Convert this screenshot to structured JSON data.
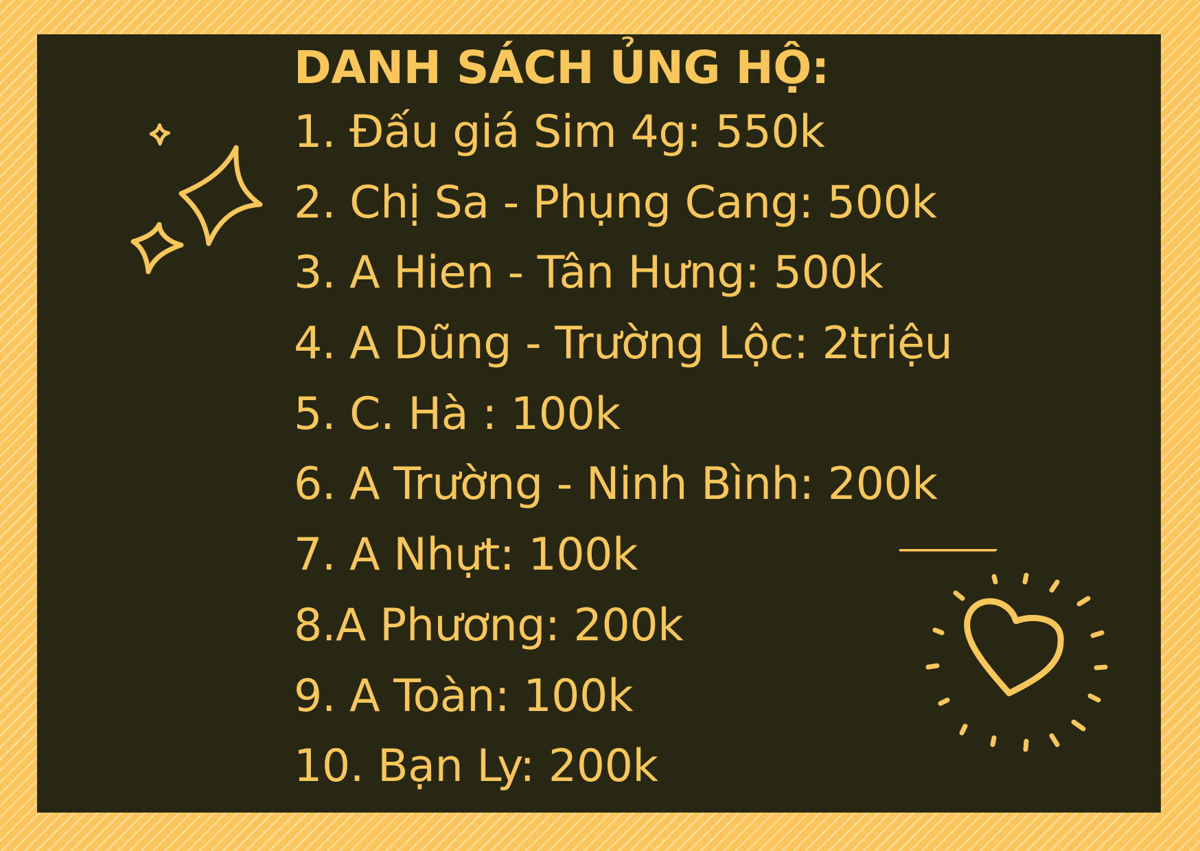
{
  "title": "DANH SÁCH ỦNG HỘ:",
  "items": [
    "1. Đấu giá Sim 4g: 550k",
    "2. Chị Sa - Phụng Cang: 500k",
    "3. A Hien - Tân Hưng: 500k",
    "4. A Dũng - Trường Lộc: 2triệu",
    "5. C. Hà : 100k",
    "6. A Trường - Ninh Bình: 200k",
    "7. A Nhựt: 100k",
    "8.A Phương: 200k",
    "9. A Toàn: 100k",
    "10. Bạn Ly: 200k"
  ],
  "colors": {
    "frame": "#fbc55c",
    "board": "#282713",
    "text": "#f9c659"
  },
  "icons": [
    "sparkles-icon",
    "heart-icon"
  ]
}
